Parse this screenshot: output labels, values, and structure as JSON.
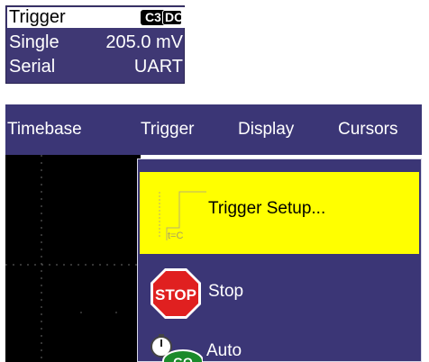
{
  "trigger_panel": {
    "title": "Trigger",
    "source_badge": "C3",
    "coupling_badge": "DC",
    "mode": "Single",
    "level": "205.0 mV",
    "type": "Serial",
    "protocol": "UART"
  },
  "menubar": {
    "items": [
      {
        "label": "Timebase"
      },
      {
        "label": "Trigger"
      },
      {
        "label": "Display"
      },
      {
        "label": "Cursors"
      }
    ]
  },
  "trigger_menu": {
    "items": [
      {
        "label": "Trigger Setup...",
        "icon": "trigger-setup-icon",
        "icon_text": "t=C",
        "highlighted": true
      },
      {
        "label": "Stop",
        "icon": "stop-sign-icon",
        "icon_text": "STOP"
      },
      {
        "label": "Auto",
        "icon": "stopwatch-go-icon",
        "icon_text": "GO"
      }
    ]
  },
  "colors": {
    "panel_bg": "#3b3676",
    "highlight": "#ffff00",
    "stop_red": "#e02020",
    "go_green": "#1a8a2a"
  }
}
